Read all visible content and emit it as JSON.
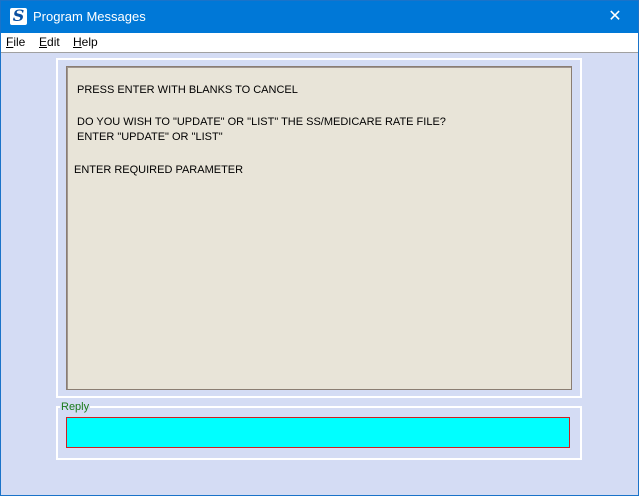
{
  "window": {
    "title": "Program Messages",
    "app_icon_glyph": "S",
    "close_glyph": "✕"
  },
  "menu": {
    "items": [
      {
        "accel": "F",
        "rest": "ile"
      },
      {
        "accel": "E",
        "rest": "dit"
      },
      {
        "accel": "H",
        "rest": "elp"
      }
    ]
  },
  "messages": {
    "lines": [
      "PRESS ENTER WITH BLANKS TO CANCEL",
      "DO YOU WISH TO \"UPDATE\" OR \"LIST\" THE SS/MEDICARE RATE FILE?",
      "ENTER \"UPDATE\" OR \"LIST\"",
      "ENTER REQUIRED PARAMETER"
    ]
  },
  "reply": {
    "label": "Reply",
    "value": ""
  },
  "colors": {
    "titlebar": "#0078d7",
    "background": "#d4dcf4",
    "message_panel": "#e8e4d8",
    "reply_input": "#00ffff",
    "reply_border": "#d02020",
    "reply_label": "#1a7a1a"
  }
}
